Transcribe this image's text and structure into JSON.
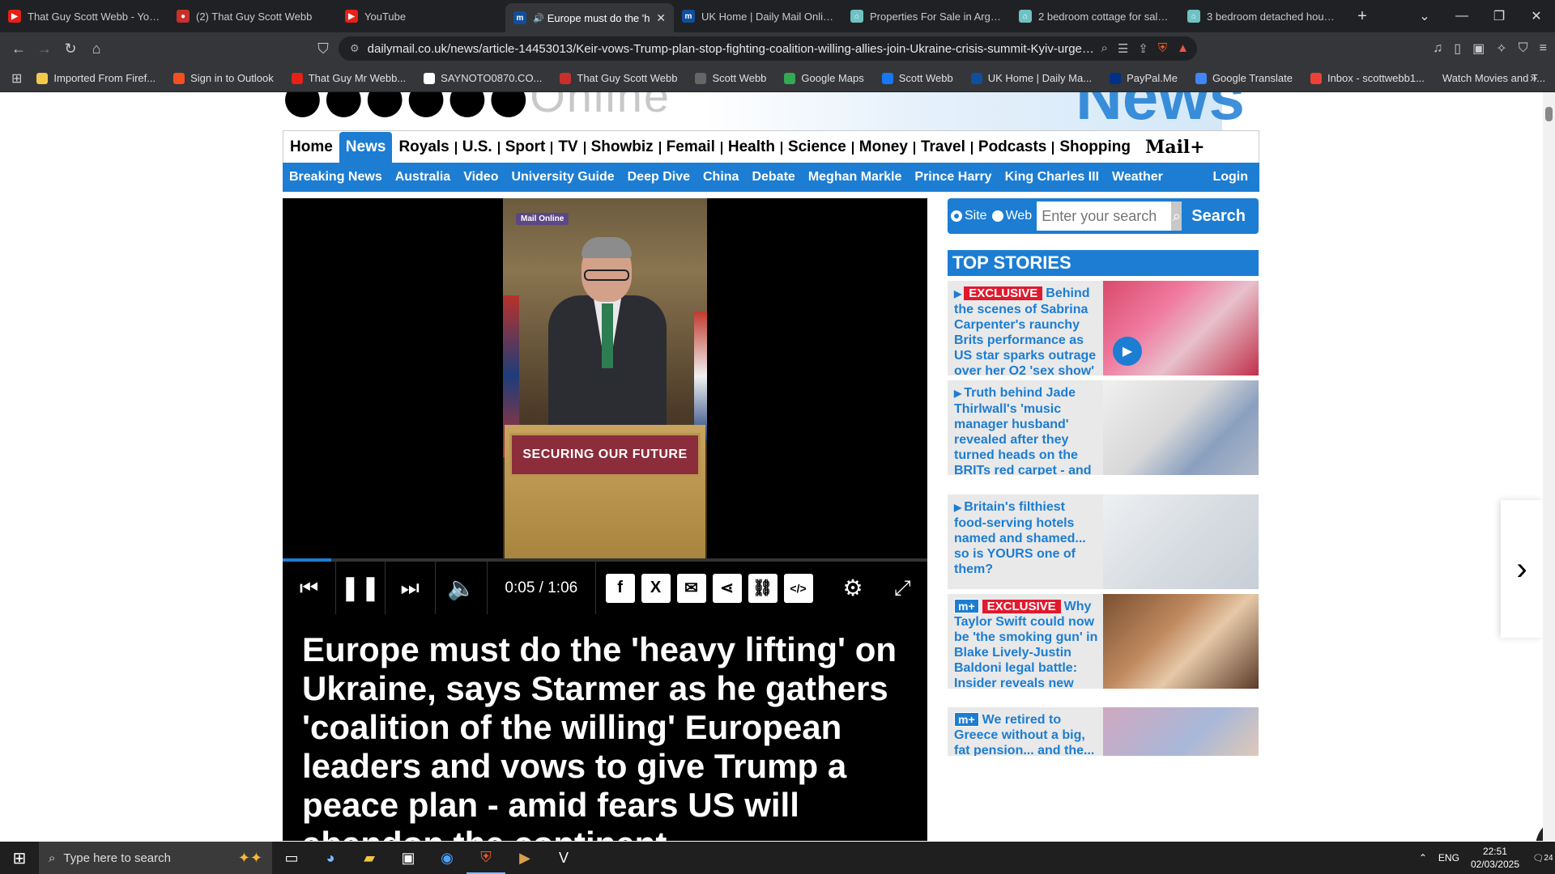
{
  "browser": {
    "tabs": [
      {
        "label": "That Guy Scott Webb - YouTu",
        "fav_color": "#e62117",
        "fav_glyph": "▶"
      },
      {
        "label": "(2) That Guy Scott Webb",
        "fav_color": "#c9302c",
        "fav_glyph": "●"
      },
      {
        "label": "YouTube",
        "fav_color": "#e62117",
        "fav_glyph": "▶"
      },
      {
        "label": "Europe must do the 'h",
        "fav_color": "#0f4f9c",
        "fav_glyph": "m",
        "active": true,
        "audio": "🔊"
      },
      {
        "label": "UK Home | Daily Mail Online",
        "fav_color": "#0f4f9c",
        "fav_glyph": "m"
      },
      {
        "label": "Properties For Sale in Argyll ar",
        "fav_color": "#6fc1c3",
        "fav_glyph": "⌂"
      },
      {
        "label": "2 bedroom cottage for sale in",
        "fav_color": "#6fc1c3",
        "fav_glyph": "⌂"
      },
      {
        "label": "3 bedroom detached house fo",
        "fav_color": "#6fc1c3",
        "fav_glyph": "⌂"
      }
    ],
    "new_tab": "+",
    "url": "dailymail.co.uk/news/article-14453013/Keir-vows-Trump-plan-stop-fighting-coalition-willing-allies-join-Ukraine-crisis-summit-Kyiv-urged-...",
    "bookmarks": [
      {
        "label": "Imported From Firef...",
        "color": "#f2c94c"
      },
      {
        "label": "Sign in to Outlook",
        "color": "#f25022"
      },
      {
        "label": "That Guy Mr Webb...",
        "color": "#e62117"
      },
      {
        "label": "SAYNOTO0870.CO...",
        "color": "#ffffff"
      },
      {
        "label": "That Guy Scott Webb",
        "color": "#c9302c"
      },
      {
        "label": "Scott Webb",
        "color": "#666666"
      },
      {
        "label": "Google Maps",
        "color": "#34a853"
      },
      {
        "label": "Scott Webb",
        "color": "#1877f2"
      },
      {
        "label": "UK Home | Daily Ma...",
        "color": "#0f4f9c"
      },
      {
        "label": "PayPal.Me",
        "color": "#003087"
      },
      {
        "label": "Google Translate",
        "color": "#4285f4"
      },
      {
        "label": "Inbox - scottwebb1...",
        "color": "#ea4335"
      },
      {
        "label": "Watch Movies and T...",
        "color": ""
      }
    ]
  },
  "site": {
    "logo_fragment": "●●●●●●",
    "logo_online": "Online",
    "news_fragment": "News",
    "nav_primary": [
      "Home",
      "News",
      "Royals",
      "U.S.",
      "Sport",
      "TV",
      "Showbiz",
      "Femail",
      "Health",
      "Science",
      "Money",
      "Travel",
      "Podcasts",
      "Shopping"
    ],
    "nav_primary_active": "News",
    "mailplus": "Mail+",
    "nav_secondary": [
      "Breaking News",
      "Australia",
      "Video",
      "University Guide",
      "Deep Dive",
      "China",
      "Debate",
      "Meghan Markle",
      "Prince Harry",
      "King Charles III",
      "Weather"
    ],
    "login": "Login",
    "accent": "#1c7dd3"
  },
  "video": {
    "brand_tag": "Mail Online",
    "podium_sign": "SECURING OUR FUTURE",
    "time": "0:05 / 1:06",
    "progress_fraction": 0.0758
  },
  "article": {
    "headline": "Europe must do the 'heavy lifting' on Ukraine, says Starmer as he gathers 'coalition of the willing' European leaders and vows to give Trump a peace plan - amid fears US will abandon the continent"
  },
  "search": {
    "option_site": "Site",
    "option_web": "Web",
    "placeholder": "Enter your search",
    "button": "Search"
  },
  "top_stories": {
    "header": "TOP STORIES",
    "items": [
      {
        "badge": "EXCLUSIVE",
        "mplus": false,
        "text": "Behind the scenes of Sabrina Carpenter's raunchy Brits performance as US star sparks outrage over her O2 'sex show'",
        "has_video": true
      },
      {
        "badge": "",
        "mplus": false,
        "text": "Truth behind Jade Thirlwall's 'music manager husband' revealed after they turned heads on the BRITs red carpet - and he looks very different in real life!",
        "has_video": false
      },
      {
        "badge": "",
        "mplus": false,
        "text": "Britain's filthiest food-serving hotels named and shamed... so is YOURS one of them?",
        "has_video": false
      },
      {
        "badge": "EXCLUSIVE",
        "mplus": true,
        "text": "Why Taylor Swift could now be 'the smoking gun' in Blake Lively-Justin Baldoni legal battle: Insider reveals new twist in It Ends With Us saga",
        "has_video": false
      },
      {
        "badge": "",
        "mplus": true,
        "text": "We retired to Greece without a big, fat pension... and the...",
        "has_video": false
      }
    ]
  },
  "taskbar": {
    "search_placeholder": "Type here to search",
    "lang": "ENG",
    "time": "22:51",
    "date": "02/03/2025",
    "notifications": "24"
  }
}
